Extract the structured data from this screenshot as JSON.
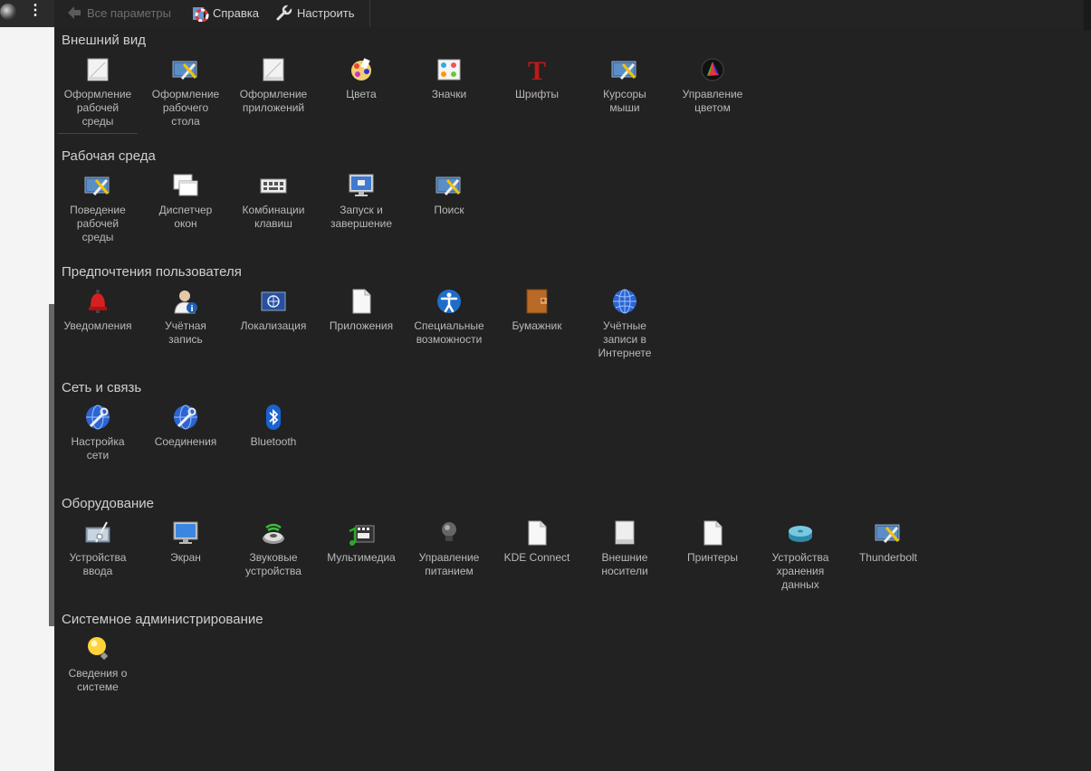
{
  "toolbar": {
    "back_label": "Все параметры",
    "help_label": "Справка",
    "configure_label": "Настроить"
  },
  "sections": [
    {
      "title": "Внешний вид",
      "items": [
        {
          "label": "Оформление\nрабочей\nсреды",
          "icon": "document-icon"
        },
        {
          "label": "Оформление\nрабочего\nстола",
          "icon": "desktop-tools-icon"
        },
        {
          "label": "Оформление\nприложений",
          "icon": "document-icon"
        },
        {
          "label": "Цвета",
          "icon": "color-palette-icon"
        },
        {
          "label": "Значки",
          "icon": "icons-grid-icon"
        },
        {
          "label": "Шрифты",
          "icon": "font-icon"
        },
        {
          "label": "Курсоры\nмыши",
          "icon": "desktop-tools-icon"
        },
        {
          "label": "Управление\nцветом",
          "icon": "color-management-icon"
        }
      ]
    },
    {
      "title": "Рабочая среда",
      "items": [
        {
          "label": "Поведение\nрабочей\nсреды",
          "icon": "desktop-tools-icon"
        },
        {
          "label": "Диспетчер\nокон",
          "icon": "windows-icon"
        },
        {
          "label": "Комбинации\nклавиш",
          "icon": "keyboard-icon"
        },
        {
          "label": "Запуск и\nзавершение",
          "icon": "monitor-icon"
        },
        {
          "label": "Поиск",
          "icon": "desktop-tools-icon"
        }
      ]
    },
    {
      "title": "Предпочтения пользователя",
      "items": [
        {
          "label": "Уведомления",
          "icon": "bell-icon"
        },
        {
          "label": "Учётная\nзапись",
          "icon": "user-icon"
        },
        {
          "label": "Локализация",
          "icon": "flag-icon"
        },
        {
          "label": "Приложения",
          "icon": "blank-document-icon"
        },
        {
          "label": "Специальные\nвозможности",
          "icon": "accessibility-icon"
        },
        {
          "label": "Бумажник",
          "icon": "wallet-icon"
        },
        {
          "label": "Учётные\nзаписи в\nИнтернете",
          "icon": "globe-icon"
        }
      ]
    },
    {
      "title": "Сеть и связь",
      "items": [
        {
          "label": "Настройка\nсети",
          "icon": "network-globe-icon"
        },
        {
          "label": "Соединения",
          "icon": "network-globe-icon"
        },
        {
          "label": "Bluetooth",
          "icon": "bluetooth-icon"
        }
      ]
    },
    {
      "title": "Оборудование",
      "items": [
        {
          "label": "Устройства\nввода",
          "icon": "input-devices-icon"
        },
        {
          "label": "Экран",
          "icon": "display-icon"
        },
        {
          "label": "Звуковые\nустройства",
          "icon": "speaker-icon"
        },
        {
          "label": "Мультимедиа",
          "icon": "multimedia-icon"
        },
        {
          "label": "Управление\nпитанием",
          "icon": "lightbulb-dark-icon"
        },
        {
          "label": "KDE Connect",
          "icon": "blank-document-icon"
        },
        {
          "label": "Внешние\nносители",
          "icon": "removable-drive-icon"
        },
        {
          "label": "Принтеры",
          "icon": "blank-document-icon"
        },
        {
          "label": "Устройства\nхранения\nданных",
          "icon": "storage-disk-icon"
        },
        {
          "label": "Thunderbolt",
          "icon": "desktop-tools-icon"
        }
      ]
    },
    {
      "title": "Системное администрирование",
      "items": [
        {
          "label": "Сведения о\nсистеме",
          "icon": "lightbulb-icon"
        }
      ]
    }
  ]
}
